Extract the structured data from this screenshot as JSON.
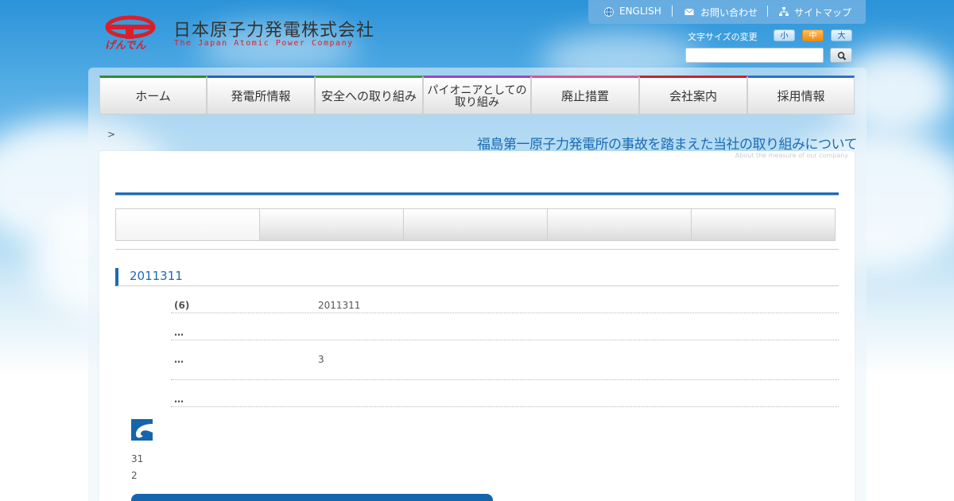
{
  "header": {
    "company_name_jp": "日本原子力発電株式会社",
    "company_name_en": "The Japan Atomic Power Company",
    "logo_text": "げんでん"
  },
  "utility_nav": {
    "english": "ENGLISH",
    "contact": "お問い合わせ",
    "sitemap": "サイトマップ"
  },
  "font_size": {
    "label": "文字サイズの変更",
    "small": "小",
    "medium": "中",
    "large": "大",
    "selected": "中"
  },
  "search": {
    "placeholder": "",
    "value": ""
  },
  "global_nav": {
    "items": [
      {
        "label": "ホーム",
        "color": "#2e8b3a"
      },
      {
        "label": "発電所情報",
        "color": "#2a62b8"
      },
      {
        "label": "安全への取り組み",
        "color": "#3d9c3d"
      },
      {
        "label": "パイオニアとしての取り組み",
        "color": "#8a4fc1"
      },
      {
        "label": "廃止措置",
        "color": "#d9548c"
      },
      {
        "label": "会社案内",
        "color": "#c4242c"
      },
      {
        "label": "採用情報",
        "color": "#2f6fc8"
      }
    ]
  },
  "breadcrumb": ">",
  "page": {
    "title": "福島第一原子力発電所の事故を踏まえた当社の取り組みについて",
    "subtitle": "About the measure of our company"
  },
  "tabs": [
    "",
    "",
    "",
    "",
    ""
  ],
  "section": {
    "heading": "2011311"
  },
  "info_rows": [
    {
      "label": "(6)",
      "value": "2011311"
    },
    {
      "label": "…",
      "value": ""
    },
    {
      "label": "…",
      "value": "3"
    },
    {
      "label": "…",
      "value": ""
    }
  ],
  "notes": [
    "31",
    "2"
  ],
  "colors": {
    "brand_red": "#d9202a",
    "accent_blue": "#1c6bb3",
    "font_size_active": "#f08c10"
  }
}
